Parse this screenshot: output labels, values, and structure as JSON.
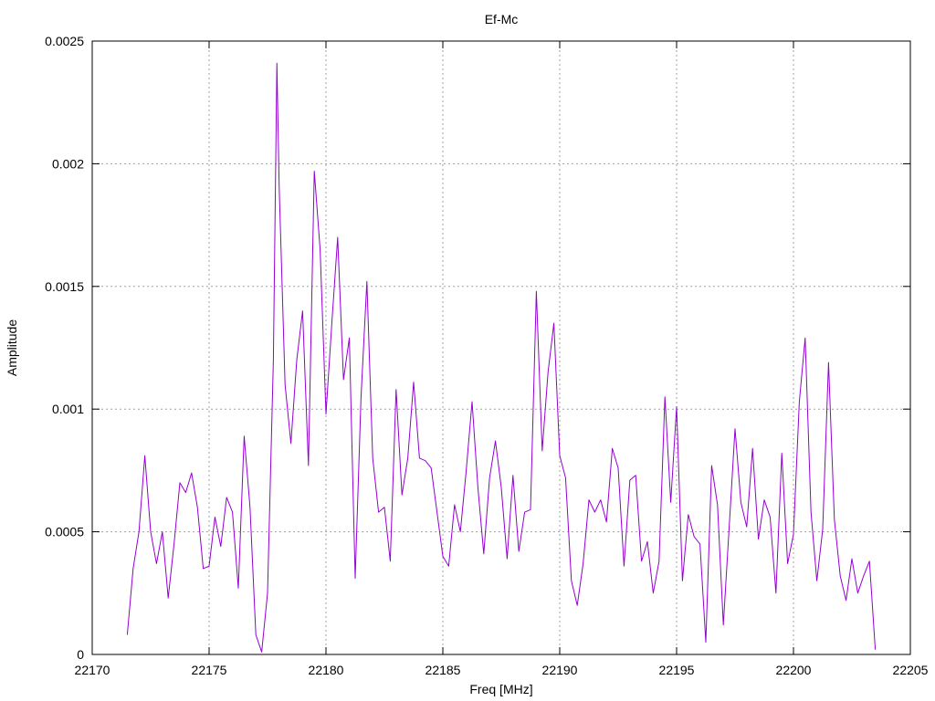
{
  "chart_data": {
    "type": "line",
    "title": "Ef-Mc",
    "xlabel": "Freq [MHz]",
    "ylabel": "Amplitude",
    "xlim": [
      22170,
      22205
    ],
    "ylim": [
      0,
      0.0025
    ],
    "x_ticks": [
      "22170",
      "22175",
      "22180",
      "22185",
      "22190",
      "22195",
      "22200",
      "22205"
    ],
    "y_ticks": [
      "0",
      "0.0005",
      "0.001",
      "0.0015",
      "0.002",
      "0.0025"
    ],
    "grid": true,
    "legend": "none",
    "series": [
      {
        "color": "#9400d3",
        "x": [
          22171.5,
          22171.75,
          22172,
          22172.25,
          22172.5,
          22172.75,
          22173,
          22173.25,
          22173.5,
          22173.75,
          22174,
          22174.25,
          22174.5,
          22174.75,
          22175,
          22175.25,
          22175.5,
          22175.75,
          22176,
          22176.25,
          22176.5,
          22176.75,
          22177,
          22177.25,
          22177.5,
          22177.75,
          22177.9,
          22178,
          22178.25,
          22178.5,
          22178.75,
          22179,
          22179.25,
          22179.5,
          22179.75,
          22180,
          22180.25,
          22180.5,
          22180.75,
          22181,
          22181.25,
          22181.5,
          22181.75,
          22182,
          22182.25,
          22182.5,
          22182.75,
          22183,
          22183.25,
          22183.5,
          22183.75,
          22184,
          22184.25,
          22184.5,
          22184.75,
          22185,
          22185.25,
          22185.5,
          22185.75,
          22186,
          22186.25,
          22186.5,
          22186.75,
          22187,
          22187.25,
          22187.5,
          22187.75,
          22188,
          22188.25,
          22188.5,
          22188.75,
          22189,
          22189.25,
          22189.5,
          22189.75,
          22190,
          22190.25,
          22190.5,
          22190.75,
          22191,
          22191.25,
          22191.5,
          22191.75,
          22192,
          22192.25,
          22192.5,
          22192.75,
          22193,
          22193.25,
          22193.5,
          22193.75,
          22194,
          22194.25,
          22194.5,
          22194.75,
          22195,
          22195.25,
          22195.5,
          22195.75,
          22196,
          22196.25,
          22196.5,
          22196.75,
          22197,
          22197.25,
          22197.5,
          22197.75,
          22198,
          22198.25,
          22198.5,
          22198.75,
          22199,
          22199.25,
          22199.5,
          22199.75,
          22200,
          22200.25,
          22200.5,
          22200.75,
          22201,
          22201.25,
          22201.5,
          22201.75,
          22202,
          22202.25,
          22202.5,
          22202.75,
          22203,
          22203.25,
          22203.5
        ],
        "values": [
          8e-05,
          0.00035,
          0.0005,
          0.00081,
          0.0005,
          0.00037,
          0.0005,
          0.00023,
          0.00045,
          0.0007,
          0.00066,
          0.00074,
          0.0006,
          0.00035,
          0.00036,
          0.00056,
          0.00044,
          0.00064,
          0.00058,
          0.00027,
          0.00089,
          0.0006,
          8e-05,
          1e-05,
          0.00025,
          0.0012,
          0.00241,
          0.0019,
          0.0011,
          0.00086,
          0.0012,
          0.0014,
          0.00077,
          0.00197,
          0.00165,
          0.00098,
          0.00135,
          0.0017,
          0.00112,
          0.00129,
          0.00031,
          0.00105,
          0.00152,
          0.0008,
          0.00058,
          0.0006,
          0.00038,
          0.00108,
          0.00065,
          0.0008,
          0.00111,
          0.0008,
          0.00079,
          0.00076,
          0.00058,
          0.0004,
          0.00036,
          0.00061,
          0.0005,
          0.00075,
          0.00103,
          0.00068,
          0.00041,
          0.00072,
          0.00087,
          0.00068,
          0.00039,
          0.00073,
          0.00042,
          0.00058,
          0.00059,
          0.00148,
          0.00083,
          0.00115,
          0.00135,
          0.00081,
          0.00072,
          0.0003,
          0.0002,
          0.00037,
          0.00063,
          0.00058,
          0.00063,
          0.00054,
          0.00084,
          0.00076,
          0.00036,
          0.00071,
          0.00073,
          0.00038,
          0.00046,
          0.00025,
          0.00038,
          0.00105,
          0.00062,
          0.00101,
          0.0003,
          0.00057,
          0.00048,
          0.00045,
          5e-05,
          0.00077,
          0.00061,
          0.00012,
          0.00052,
          0.00092,
          0.00062,
          0.00052,
          0.00084,
          0.00047,
          0.00063,
          0.00056,
          0.00025,
          0.00082,
          0.00037,
          0.00049,
          0.00103,
          0.00129,
          0.00058,
          0.0003,
          0.00051,
          0.00119,
          0.00055,
          0.00032,
          0.00022,
          0.00039,
          0.00025,
          0.00032,
          0.00038,
          2e-05
        ]
      }
    ]
  }
}
